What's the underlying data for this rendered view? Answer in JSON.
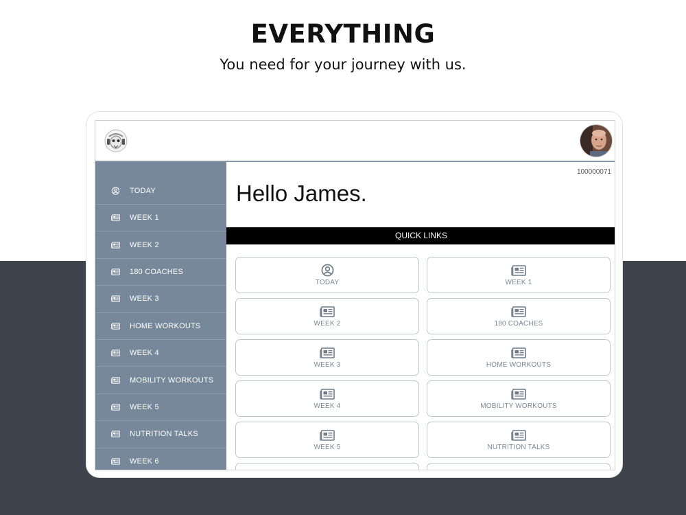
{
  "hero": {
    "title": "EVERYTHING",
    "subtitle": "You need for your journey with us."
  },
  "app": {
    "user_id": "100000071",
    "greeting": "Hello James.",
    "quick_links_title": "QUICK LINKS"
  },
  "sidebar": {
    "items": [
      {
        "label": "TODAY",
        "icon": "user-circle-icon"
      },
      {
        "label": "WEEK 1",
        "icon": "newspaper-icon"
      },
      {
        "label": "WEEK 2",
        "icon": "newspaper-icon"
      },
      {
        "label": "180 COACHES",
        "icon": "newspaper-icon"
      },
      {
        "label": "WEEK 3",
        "icon": "newspaper-icon"
      },
      {
        "label": "HOME WORKOUTS",
        "icon": "newspaper-icon"
      },
      {
        "label": "WEEK 4",
        "icon": "newspaper-icon"
      },
      {
        "label": "MOBILITY WORKOUTS",
        "icon": "newspaper-icon"
      },
      {
        "label": "WEEK 5",
        "icon": "newspaper-icon"
      },
      {
        "label": "NUTRITION TALKS",
        "icon": "newspaper-icon"
      },
      {
        "label": "WEEK 6",
        "icon": "newspaper-icon"
      }
    ]
  },
  "quick_links": [
    {
      "label": "TODAY",
      "icon": "user-circle-icon"
    },
    {
      "label": "WEEK 1",
      "icon": "newspaper-icon"
    },
    {
      "label": "WEEK 2",
      "icon": "newspaper-icon"
    },
    {
      "label": "180 COACHES",
      "icon": "newspaper-icon"
    },
    {
      "label": "WEEK 3",
      "icon": "newspaper-icon"
    },
    {
      "label": "HOME WORKOUTS",
      "icon": "newspaper-icon"
    },
    {
      "label": "WEEK 4",
      "icon": "newspaper-icon"
    },
    {
      "label": "MOBILITY WORKOUTS",
      "icon": "newspaper-icon"
    },
    {
      "label": "WEEK 5",
      "icon": "newspaper-icon"
    },
    {
      "label": "NUTRITION TALKS",
      "icon": "newspaper-icon"
    },
    {
      "label": "",
      "icon": "newspaper-icon"
    },
    {
      "label": "",
      "icon": "newspaper-icon"
    }
  ],
  "colors": {
    "sidebar_bg": "#77889a",
    "dark_band": "#3d444c",
    "quick_links_bar": "#000000",
    "tile_text": "#7a8693"
  }
}
